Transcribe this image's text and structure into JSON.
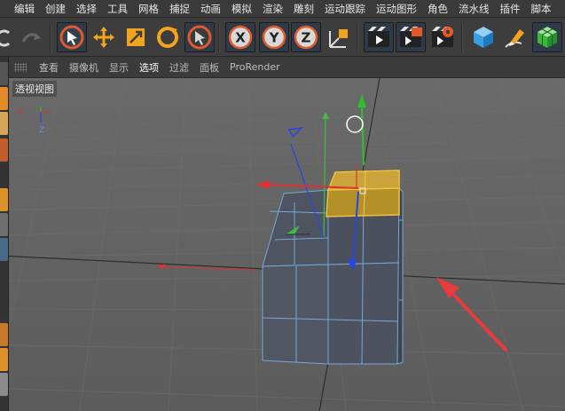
{
  "menu": [
    "编辑",
    "创建",
    "选择",
    "工具",
    "网格",
    "捕捉",
    "动画",
    "模拟",
    "渲染",
    "雕刻",
    "运动跟踪",
    "运动图形",
    "角色",
    "流水线",
    "插件",
    "脚本"
  ],
  "toolbar": {
    "axis_x": "X",
    "axis_y": "Y",
    "axis_z": "Z"
  },
  "viewport_menu": [
    "查看",
    "摄像机",
    "显示",
    "选项",
    "过滤",
    "面板",
    "ProRender"
  ],
  "viewport_menu_active_index": 3,
  "viewport_label": "透视视图",
  "axis_labels": {
    "x": "X",
    "y": "Y",
    "z": "Z"
  },
  "colors": {
    "accent_orange": "#f0a020",
    "selection_yellow": "#e0b22a",
    "axis_red": "#e03030",
    "axis_green": "#2ec02e",
    "axis_blue": "#2a45e0",
    "viewport_bg": "#646464",
    "arrow_red": "#e83b3b"
  },
  "icons": [
    "undo-icon",
    "redo-icon",
    "select-cursor-icon",
    "move-icon",
    "scale-icon",
    "rotate-icon",
    "live-select-icon",
    "x-axis-lock-icon",
    "y-axis-lock-icon",
    "z-axis-lock-icon",
    "coordinate-system-icon",
    "render-view-icon",
    "render-picture-viewer-icon",
    "render-settings-icon",
    "cube-icon",
    "pen-icon",
    "subdivision-icon"
  ]
}
